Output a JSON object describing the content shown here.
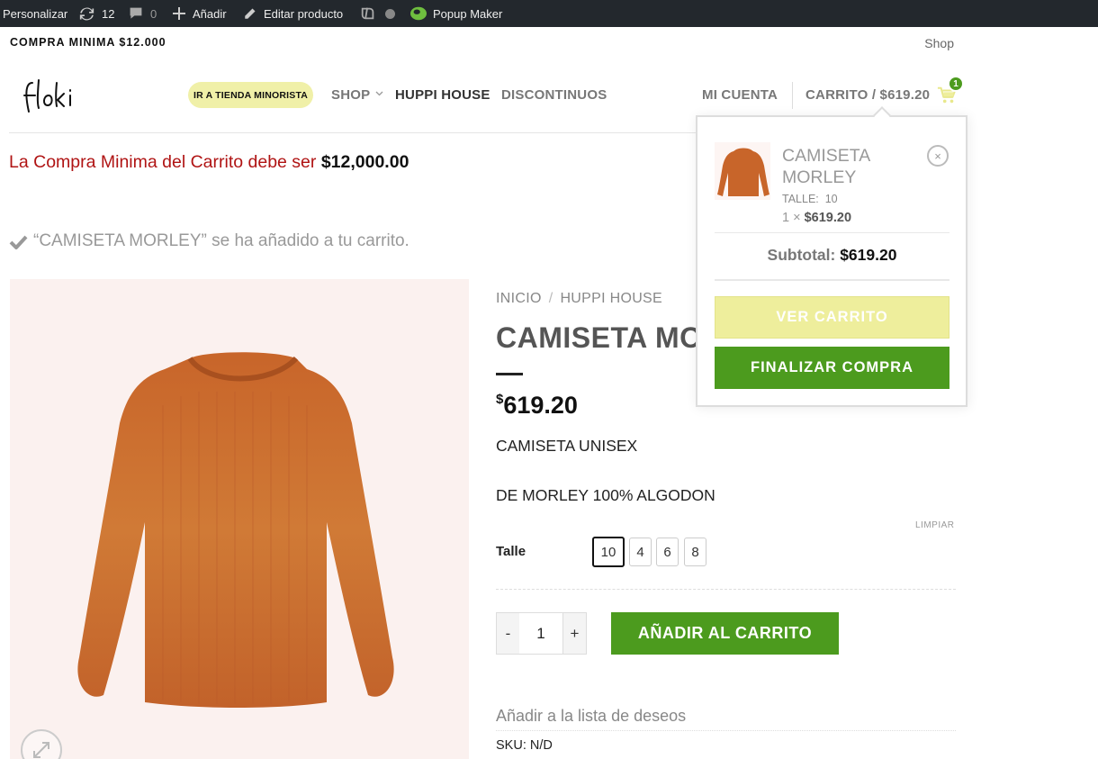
{
  "admin_bar": {
    "customize": "Personalizar",
    "updates_count": "12",
    "comments_count": "0",
    "add_new": "Añadir",
    "edit_product": "Editar producto",
    "popup_maker": "Popup Maker"
  },
  "top_bar": {
    "left_text": "COMPRA MINIMA $12.000",
    "right_link": "Shop"
  },
  "nav": {
    "retail_store_pill": "IR A TIENDA MINORISTA",
    "shop": "SHOP",
    "huppi_house": "HUPPI HOUSE",
    "discontinued": "DISCONTINUOS",
    "my_account": "MI CUENTA",
    "cart_label": "CARRITO / $619.20",
    "cart_count": "1"
  },
  "notices": {
    "min_cart_text": "La Compra Minima del Carrito debe ser ",
    "min_cart_amount": "$12,000.00",
    "added_message": "“CAMISETA MORLEY” se ha añadido a tu carrito."
  },
  "product": {
    "breadcrumb_home": "INICIO",
    "breadcrumb_sep": "/",
    "breadcrumb_category": "HUPPI HOUSE",
    "title": "CAMISETA MORLEY",
    "currency_symbol": "$",
    "price": "619.20",
    "description_line1": "CAMISETA UNISEX",
    "description_line2": "DE MORLEY 100% ALGODON",
    "clear_label": "LIMPIAR",
    "size_label": "Talle",
    "sizes": [
      "10",
      "4",
      "6",
      "8"
    ],
    "selected_size": "10",
    "qty_minus": "-",
    "qty_value": "1",
    "qty_plus": "+",
    "add_to_cart": "AÑADIR AL CARRITO",
    "wishlist": "Añadir a la lista de deseos",
    "sku_line": "SKU: N/D",
    "image_color": "#c96a2c"
  },
  "cart_dropdown": {
    "item_name": "CAMISETA MORLEY",
    "item_meta": "TALLE:  10",
    "item_qty_prefix": "1 × ",
    "item_price": "$619.20",
    "remove_symbol": "×",
    "subtotal_label": "Subtotal: ",
    "subtotal_value": "$619.20",
    "view_cart": "VER CARRITO",
    "checkout": "FINALIZAR COMPRA"
  },
  "colors": {
    "accent_green": "#4c9b1e",
    "pill_yellow": "#f0f0a8",
    "notice_red": "#b01414"
  }
}
